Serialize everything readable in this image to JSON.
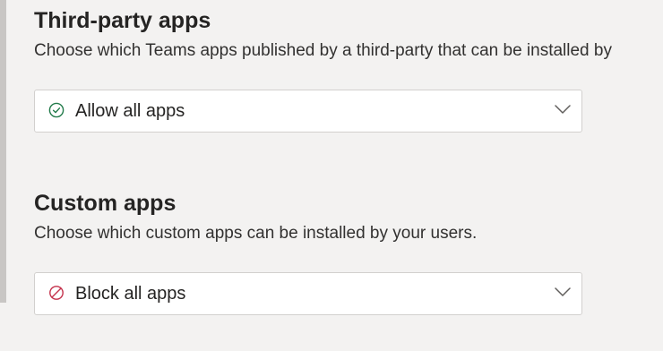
{
  "third_party": {
    "title": "Third-party apps",
    "description": "Choose which Teams apps published by a third-party that can be installed by",
    "selected_value": "Allow all apps",
    "status_icon": "check-circle-icon",
    "status_color": "#237b4b"
  },
  "custom": {
    "title": "Custom apps",
    "description": "Choose which custom apps can be installed by your users.",
    "selected_value": "Block all apps",
    "status_icon": "blocked-icon",
    "status_color": "#c4314b"
  }
}
